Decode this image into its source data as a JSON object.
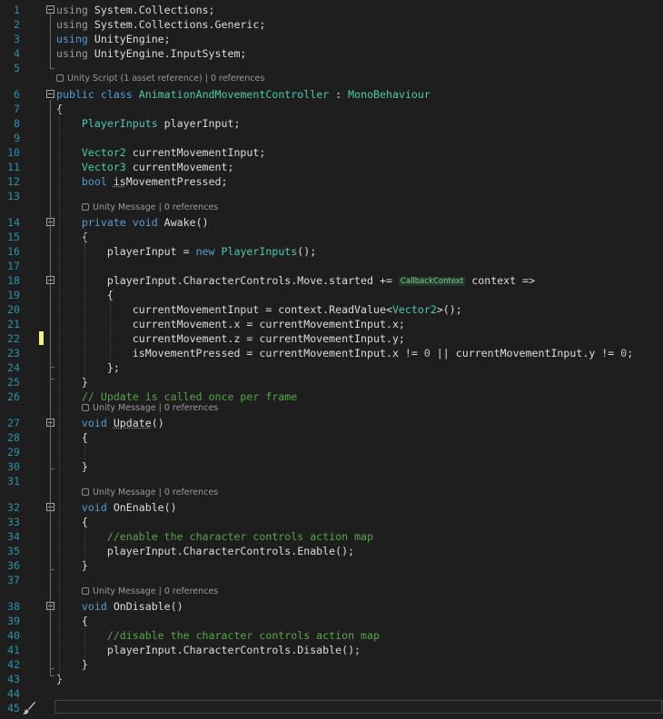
{
  "editor": {
    "lens_script": "Unity Script (1 asset reference) | 0 references",
    "lens_message": "Unity Message | 0 references",
    "lines": [
      {
        "n": "1",
        "toks": [
          [
            "d",
            "using"
          ],
          [
            "p",
            " System.Collections;"
          ]
        ]
      },
      {
        "n": "2",
        "toks": [
          [
            "d",
            "using"
          ],
          [
            "p",
            " System.Collections.Generic;"
          ]
        ]
      },
      {
        "n": "3",
        "toks": [
          [
            "k",
            "using"
          ],
          [
            "p",
            " UnityEngine;"
          ]
        ]
      },
      {
        "n": "4",
        "toks": [
          [
            "d",
            "using"
          ],
          [
            "p",
            " UnityEngine.InputSystem;"
          ]
        ]
      },
      {
        "n": "5",
        "toks": []
      },
      {
        "n": "6",
        "toks": [
          [
            "k",
            "public"
          ],
          [
            "p",
            " "
          ],
          [
            "k",
            "class"
          ],
          [
            "p",
            " "
          ],
          [
            "t",
            "AnimationAndMovementController"
          ],
          [
            "p",
            " : "
          ],
          [
            "t",
            "MonoBehaviour"
          ]
        ]
      },
      {
        "n": "7",
        "toks": [
          [
            "p",
            "{"
          ]
        ]
      },
      {
        "n": "8",
        "toks": [
          [
            "p",
            "    "
          ],
          [
            "t",
            "PlayerInputs"
          ],
          [
            "p",
            " playerInput;"
          ]
        ]
      },
      {
        "n": "9",
        "toks": []
      },
      {
        "n": "10",
        "toks": [
          [
            "p",
            "    "
          ],
          [
            "t",
            "Vector2"
          ],
          [
            "p",
            " currentMovementInput;"
          ]
        ]
      },
      {
        "n": "11",
        "toks": [
          [
            "p",
            "    "
          ],
          [
            "t",
            "Vector3"
          ],
          [
            "p",
            " currentMovement;"
          ]
        ]
      },
      {
        "n": "12",
        "toks": [
          [
            "p",
            "    "
          ],
          [
            "k",
            "bool"
          ],
          [
            "p",
            " "
          ],
          [
            "sq",
            "is"
          ],
          [
            "p",
            "MovementPressed;"
          ]
        ]
      },
      {
        "n": "13",
        "toks": []
      },
      {
        "n": "14",
        "toks": [
          [
            "p",
            "    "
          ],
          [
            "k",
            "private"
          ],
          [
            "p",
            " "
          ],
          [
            "k",
            "void"
          ],
          [
            "p",
            " Awake()"
          ]
        ]
      },
      {
        "n": "15",
        "toks": [
          [
            "p",
            "    {"
          ]
        ]
      },
      {
        "n": "16",
        "toks": [
          [
            "p",
            "        playerInput = "
          ],
          [
            "k",
            "new"
          ],
          [
            "p",
            " "
          ],
          [
            "t",
            "PlayerInputs"
          ],
          [
            "p",
            "();"
          ]
        ]
      },
      {
        "n": "17",
        "toks": []
      },
      {
        "n": "18",
        "toks": [
          [
            "p",
            "        playerInput.CharacterControls.Move.started += "
          ],
          [
            "hint",
            "CallbackContext"
          ],
          [
            "p",
            " context =>"
          ]
        ]
      },
      {
        "n": "19",
        "toks": [
          [
            "p",
            "        {"
          ]
        ]
      },
      {
        "n": "20",
        "toks": [
          [
            "p",
            "            currentMovementInput = context.ReadValue<"
          ],
          [
            "t",
            "Vector2"
          ],
          [
            "p",
            ">();"
          ]
        ]
      },
      {
        "n": "21",
        "toks": [
          [
            "p",
            "            currentMovement.x = currentMovementInput.x;"
          ]
        ]
      },
      {
        "n": "22",
        "toks": [
          [
            "p",
            "            currentMovement.z = currentMovementInput.y;"
          ]
        ]
      },
      {
        "n": "23",
        "toks": [
          [
            "p",
            "            isMovementPressed = currentMovementInput.x != "
          ],
          [
            "n",
            "0"
          ],
          [
            "p",
            " || currentMovementInput.y != "
          ],
          [
            "n",
            "0"
          ],
          [
            "p",
            ";"
          ]
        ]
      },
      {
        "n": "24",
        "toks": [
          [
            "p",
            "        };"
          ]
        ]
      },
      {
        "n": "25",
        "toks": [
          [
            "p",
            "    }"
          ]
        ]
      },
      {
        "n": "26",
        "toks": [
          [
            "p",
            "    "
          ],
          [
            "c",
            "// Update is called once per frame"
          ]
        ]
      },
      {
        "n": "27",
        "toks": [
          [
            "p",
            "    "
          ],
          [
            "k",
            "void"
          ],
          [
            "p",
            " "
          ],
          [
            "sq",
            "Update"
          ],
          [
            "p",
            "()"
          ]
        ]
      },
      {
        "n": "28",
        "toks": [
          [
            "p",
            "    {"
          ]
        ]
      },
      {
        "n": "29",
        "toks": []
      },
      {
        "n": "30",
        "toks": [
          [
            "p",
            "    }"
          ]
        ]
      },
      {
        "n": "31",
        "toks": []
      },
      {
        "n": "32",
        "toks": [
          [
            "p",
            "    "
          ],
          [
            "k",
            "void"
          ],
          [
            "p",
            " OnEnable()"
          ]
        ]
      },
      {
        "n": "33",
        "toks": [
          [
            "p",
            "    {"
          ]
        ]
      },
      {
        "n": "34",
        "toks": [
          [
            "p",
            "        "
          ],
          [
            "c",
            "//enable the character controls action map"
          ]
        ]
      },
      {
        "n": "35",
        "toks": [
          [
            "p",
            "        playerInput.CharacterControls.Enable();"
          ]
        ]
      },
      {
        "n": "36",
        "toks": [
          [
            "p",
            "    }"
          ]
        ]
      },
      {
        "n": "37",
        "toks": []
      },
      {
        "n": "38",
        "toks": [
          [
            "p",
            "    "
          ],
          [
            "k",
            "void"
          ],
          [
            "p",
            " OnDisable()"
          ]
        ]
      },
      {
        "n": "39",
        "toks": [
          [
            "p",
            "    {"
          ]
        ]
      },
      {
        "n": "40",
        "toks": [
          [
            "p",
            "        "
          ],
          [
            "c",
            "//disable the character controls action map"
          ]
        ]
      },
      {
        "n": "41",
        "toks": [
          [
            "p",
            "        playerInput.CharacterControls.Disable();"
          ]
        ]
      },
      {
        "n": "42",
        "toks": [
          [
            "p",
            "    }"
          ]
        ]
      },
      {
        "n": "43",
        "toks": [
          [
            "p",
            "}"
          ]
        ]
      },
      {
        "n": "44",
        "toks": []
      },
      {
        "n": "45",
        "toks": []
      }
    ]
  },
  "colors": {
    "background": "#1e1e1e",
    "line_number": "#2b91af",
    "keyword": "#569cd6",
    "type": "#4ec9b0",
    "comment": "#57a64a",
    "number": "#b5cea8",
    "change_marker": "#efef91"
  },
  "icons": {
    "codelens": "unity-icon",
    "bottom_left": "paintbrush-icon"
  }
}
